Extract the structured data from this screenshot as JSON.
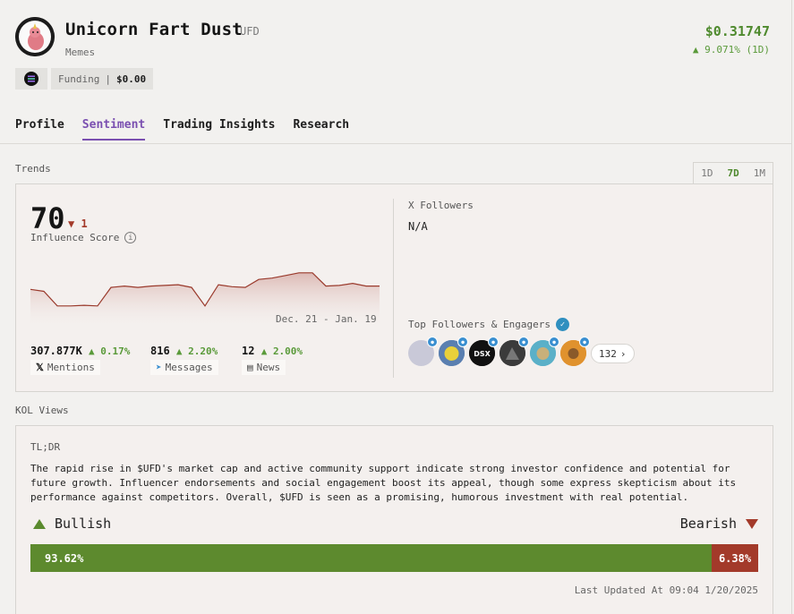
{
  "token": {
    "name": "Unicorn Fart Dust",
    "symbol": "UFD",
    "category": "Memes",
    "price": "$0.31747",
    "change": "9.071% (1D)",
    "funding_label": "Funding",
    "funding_value": "$0.00"
  },
  "tabs": [
    "Profile",
    "Sentiment",
    "Trading Insights",
    "Research"
  ],
  "active_tab": "Sentiment",
  "trends": {
    "label": "Trends",
    "ranges": [
      "1D",
      "7D",
      "1M"
    ],
    "active_range": "7D",
    "score": "70",
    "score_delta": "1",
    "score_label": "Influence Score",
    "date_range": "Dec. 21 - Jan. 19",
    "chart_values": [
      55,
      52,
      30,
      30,
      31,
      30,
      58,
      60,
      58,
      60,
      61,
      62,
      58,
      30,
      62,
      59,
      58,
      70,
      72,
      76,
      80,
      80,
      60,
      61,
      64,
      60,
      60
    ],
    "stats": [
      {
        "value": "307.877K",
        "pct": "0.17%",
        "tag": "Mentions"
      },
      {
        "value": "816",
        "pct": "2.20%",
        "tag": "Messages"
      },
      {
        "value": "12",
        "pct": "2.00%",
        "tag": "News"
      }
    ],
    "x_followers_label": "X Followers",
    "x_followers_value": "N/A",
    "top_followers_label": "Top Followers & Engagers",
    "more_count": "132"
  },
  "kol": {
    "label": "KOL Views",
    "tldr_label": "TL;DR",
    "tldr_text": "The rapid rise in $UFD's market cap and active community support indicate strong investor confidence and potential for future growth. Influencer endorsements and social engagement boost its appeal, though some express skepticism about its performance against competitors. Overall, $UFD is seen as a promising, humorous investment with real potential.",
    "bullish_label": "Bullish",
    "bearish_label": "Bearish",
    "bullish_pct": "93.62%",
    "bearish_pct": "6.38%",
    "bullish_value": 93.62,
    "updated": "Last Updated At 09:04 1/20/2025"
  },
  "colors": {
    "accent": "#7a4fb0",
    "positive": "#5a9a3a",
    "negative": "#a33a2a"
  }
}
